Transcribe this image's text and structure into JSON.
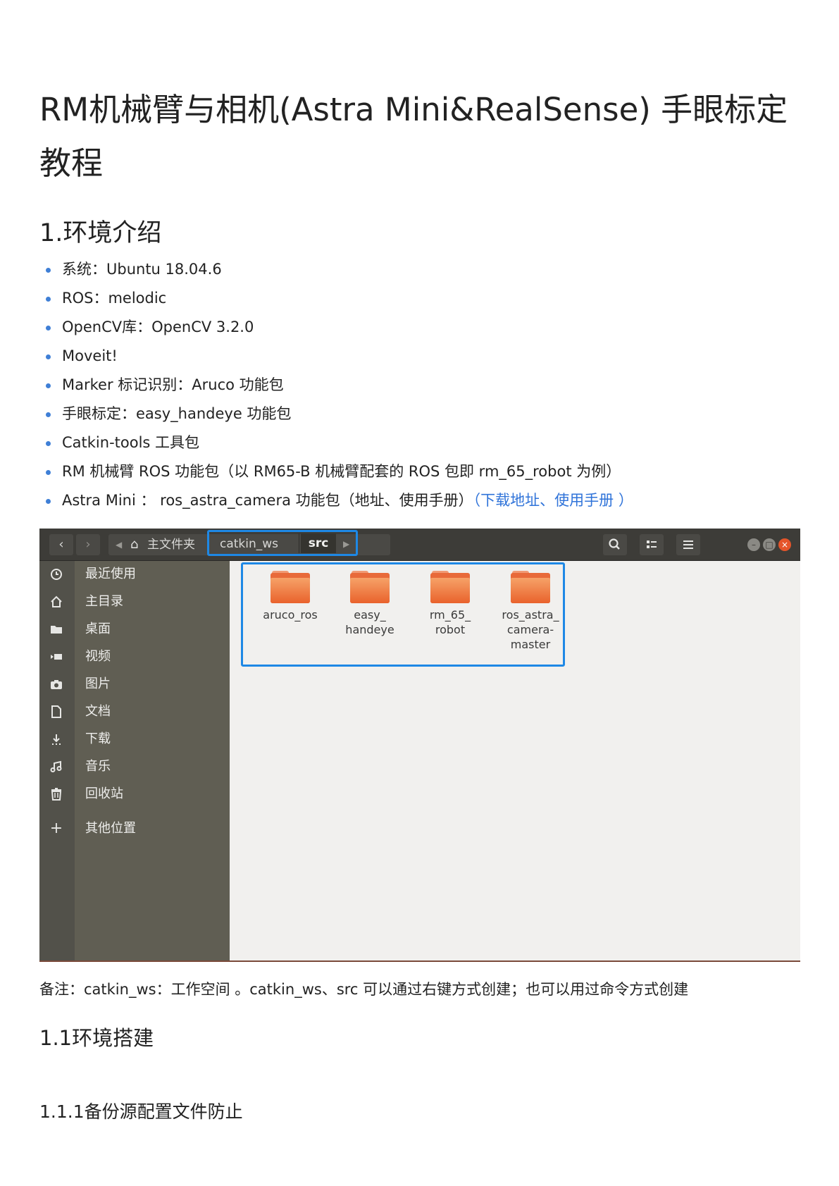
{
  "doc": {
    "title": "RM机械臂与相机(Astra Mini&RealSense) 手眼标定教程",
    "section1": "1.环境介绍",
    "items": [
      {
        "text": "系统：Ubuntu 18.04.6"
      },
      {
        "text": "ROS：melodic"
      },
      {
        "text": "OpenCV库：OpenCV 3.2.0"
      },
      {
        "text": "Moveit!"
      },
      {
        "text": "Marker 标记识别：Aruco 功能包"
      },
      {
        "text": "手眼标定：easy_handeye 功能包"
      },
      {
        "text": "Catkin-tools 工具包"
      },
      {
        "text": "RM 机械臂 ROS 功能包（以 RM65-B 机械臂配套的 ROS 包即 rm_65_robot 为例）"
      },
      {
        "text": "Astra Mini ： ros_astra_camera 功能包（地址、使用手册）",
        "link": "（下载地址、使用手册 ）"
      }
    ],
    "note": "备注：catkin_ws：工作空间 。catkin_ws、src 可以通过右键方式创建；也可以用过命令方式创建",
    "section1_1": "1.1环境搭建",
    "section1_1_1": "1.1.1备份源配置文件防止"
  },
  "file_manager": {
    "breadcrumb": {
      "home": "主文件夹",
      "folder1": "catkin_ws",
      "folder2": "src"
    },
    "sidebar": [
      {
        "label": "最近使用",
        "icon": "clock-icon"
      },
      {
        "label": "主目录",
        "icon": "home-icon"
      },
      {
        "label": "桌面",
        "icon": "folder-icon"
      },
      {
        "label": "视频",
        "icon": "video-icon"
      },
      {
        "label": "图片",
        "icon": "camera-icon"
      },
      {
        "label": "文档",
        "icon": "document-icon"
      },
      {
        "label": "下载",
        "icon": "download-icon"
      },
      {
        "label": "音乐",
        "icon": "music-icon"
      },
      {
        "label": "回收站",
        "icon": "trash-icon"
      },
      {
        "label": "其他位置",
        "icon": "plus-icon"
      }
    ],
    "files": [
      {
        "name": "aruco_ros"
      },
      {
        "name": "easy_\nhandeye"
      },
      {
        "name": "rm_65_\nrobot"
      },
      {
        "name": "ros_astra_\ncamera-\nmaster"
      }
    ]
  },
  "colors": {
    "accent": "#1e88e5",
    "link": "#2f73d9",
    "sidebar": "#605e53",
    "headerbar": "#3d3c38"
  }
}
